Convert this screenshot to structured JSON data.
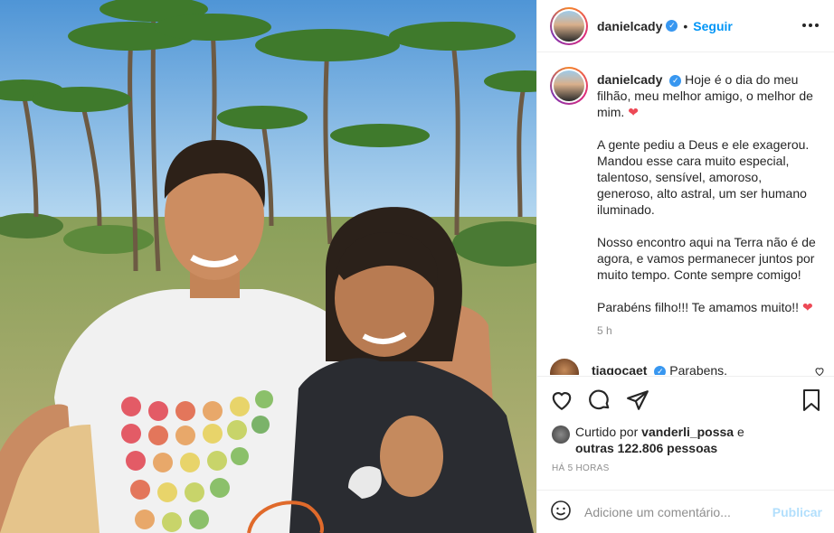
{
  "header": {
    "username": "danielcady",
    "separator": "•",
    "follow_label": "Seguir",
    "more_label": "•••"
  },
  "caption": {
    "username": "danielcady",
    "paragraphs": [
      "Hoje é o dia do meu filhão, meu melhor amigo, o melhor de mim.",
      "A gente pediu a Deus e ele exagerou. Mandou esse cara muito especial, talentoso, sensível, amoroso, generoso, alto astral, um ser humano iluminado.",
      "Nosso encontro aqui na Terra não é de agora, e vamos permanecer juntos por muito tempo. Conte sempre comigo!",
      "Parabéns filho!!! Te amamos muito!!"
    ],
    "heart": "❤",
    "time": "5 h"
  },
  "comments": [
    {
      "username": "tiagocaet",
      "text": "Parabens, Marcelinhooooo!! Tio mandando"
    }
  ],
  "likes": {
    "prefix": "Curtido por",
    "user": "vanderli_possa",
    "suffix": "e",
    "others": "outras 122.806 pessoas"
  },
  "timestamp": "HÁ 5 HORAS",
  "add_comment": {
    "placeholder": "Adicione um comentário...",
    "publish_label": "Publicar"
  },
  "colors": {
    "accent": "#0095f6",
    "heart": "#ed4956",
    "publish_disabled": "#b2dffc",
    "muted": "#8e8e8e"
  },
  "icons": [
    "verified-icon",
    "heart-icon",
    "comment-icon",
    "share-icon",
    "bookmark-icon",
    "emoji-icon",
    "more-icon"
  ]
}
